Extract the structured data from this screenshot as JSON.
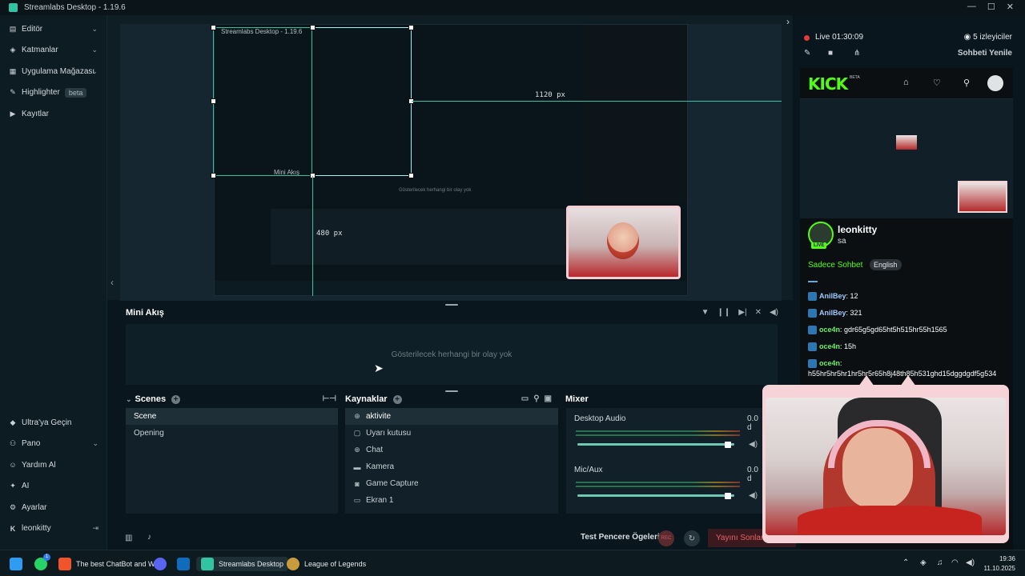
{
  "window": {
    "title": "Streamlabs Desktop - 1.19.6"
  },
  "sidebar": {
    "items": [
      {
        "label": "Editör",
        "icon": "editor-icon",
        "has_chevron": true
      },
      {
        "label": "Katmanlar",
        "icon": "layers-icon",
        "has_chevron": true
      },
      {
        "label": "Uygulama Mağazası",
        "icon": "store-icon",
        "has_chevron": true
      },
      {
        "label": "Highlighter",
        "icon": "highlighter-icon",
        "badge": "beta"
      },
      {
        "label": "Kayıtlar",
        "icon": "recordings-icon"
      }
    ],
    "bottom_items": [
      {
        "label": "Ultra'ya Geçin",
        "icon": "ultra-icon"
      },
      {
        "label": "Pano",
        "icon": "dashboard-icon",
        "has_chevron": true
      },
      {
        "label": "Yardım Al",
        "icon": "help-icon"
      },
      {
        "label": "AI",
        "icon": "ai-icon"
      },
      {
        "label": "Ayarlar",
        "icon": "settings-icon"
      },
      {
        "label": "leonkitty",
        "icon": "kick-icon"
      }
    ]
  },
  "preview": {
    "measure_h": "1120 px",
    "measure_v": "480 px",
    "nested_title": "Streamlabs Desktop - 1.19.6",
    "nested_mini": "Mini Akış",
    "nested_empty": "Gösterilecek herhangi bir olay yok"
  },
  "mini_akis": {
    "title": "Mini Akış",
    "empty_text": "Gösterilecek herhangi bir olay yok"
  },
  "scenes": {
    "title": "Scenes",
    "items": [
      "Scene",
      "Opening"
    ],
    "selected": "Scene"
  },
  "sources": {
    "title": "Kaynaklar",
    "items": [
      {
        "label": "aktivite",
        "icon": "globe-icon"
      },
      {
        "label": "Uyarı kutusu",
        "icon": "alert-box-icon"
      },
      {
        "label": "Chat",
        "icon": "globe-icon"
      },
      {
        "label": "Kamera",
        "icon": "folder-icon"
      },
      {
        "label": "Game Capture",
        "icon": "gamepad-icon"
      },
      {
        "label": "Ekran 1",
        "icon": "monitor-icon"
      }
    ],
    "selected": "aktivite"
  },
  "mixer": {
    "title": "Mixer",
    "channels": [
      {
        "name": "Desktop Audio",
        "value": "0.0 d",
        "level": 0.96
      },
      {
        "name": "Mic/Aux",
        "value": "0.0 d",
        "level": 0.96
      }
    ]
  },
  "footer": {
    "test_label": "Test Pencere Ögeleri",
    "rec_label": "REC",
    "end_stream_label": "Yayını Sonland"
  },
  "chat_panel": {
    "live_label": "Live 01:30:09",
    "viewers_label": "5 izleyiciler",
    "refresh_label": "Sohbeti Yenile",
    "kick": {
      "logo": "KICK",
      "beta": "BETA",
      "channel_name": "leonkitty",
      "channel_sub": "sa",
      "live_badge": "LIVE",
      "chat_mode": "Sadece Sohbet",
      "language": "English"
    },
    "messages": [
      {
        "user": "AnilBey",
        "text": "12",
        "color": "blue"
      },
      {
        "user": "AnilBey",
        "text": "321",
        "color": "blue"
      },
      {
        "user": "oce4n",
        "text": "gdr65g5gd65ht5h515hr55h1565",
        "color": "green"
      },
      {
        "user": "oce4n",
        "text": "15h",
        "color": "green"
      },
      {
        "user": "oce4n",
        "text": "h55hr5hr5hr1hr5hr5r65h8j48th85h531ghd15dggdgdf5g534",
        "color": "green"
      }
    ]
  },
  "taskbar": {
    "items": [
      {
        "label": "The best ChatBot and W",
        "icon": "brave-icon"
      },
      {
        "label": "Streamlabs Desktop",
        "icon": "streamlabs-icon",
        "active": true
      },
      {
        "label": "League of Legends",
        "icon": "league-icon"
      }
    ],
    "whatsapp_badge": "1",
    "time": "19:36",
    "date": "11.10.2025"
  },
  "colors": {
    "accent": "#31c3a2",
    "kick_green": "#53fc18",
    "live_red": "#e53a3a",
    "background": "#09161d"
  }
}
